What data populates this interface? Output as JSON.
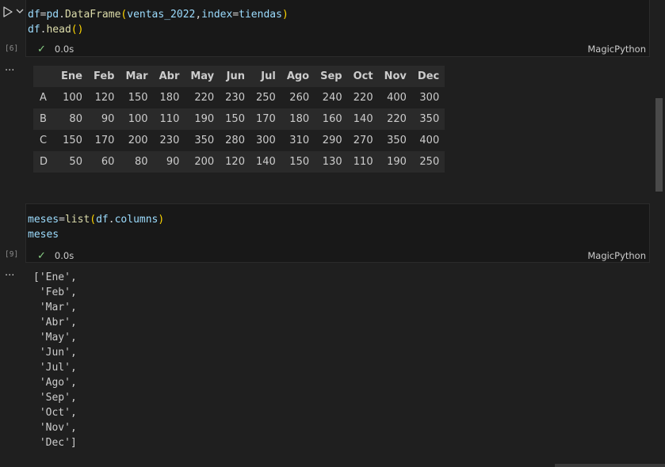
{
  "cells": [
    {
      "exec_count": "[6]",
      "code_lines": [
        [
          [
            "t-var",
            "df"
          ],
          [
            "t-op",
            "="
          ],
          [
            "t-var",
            "pd"
          ],
          [
            "t-op",
            "."
          ],
          [
            "t-fn",
            "DataFrame"
          ],
          [
            "t-paren",
            "("
          ],
          [
            "t-var",
            "ventas_2022"
          ],
          [
            "t-op",
            ","
          ],
          [
            "t-var",
            "index"
          ],
          [
            "t-op",
            "="
          ],
          [
            "t-var",
            "tiendas"
          ],
          [
            "t-paren",
            ")"
          ]
        ],
        [
          [
            "t-var",
            "df"
          ],
          [
            "t-op",
            "."
          ],
          [
            "t-fn",
            "head"
          ],
          [
            "t-paren",
            "()"
          ]
        ]
      ],
      "status_time": "0.0s",
      "kernel": "MagicPython"
    },
    {
      "exec_count": "[9]",
      "code_lines": [
        [
          [
            "t-var",
            "meses"
          ],
          [
            "t-op",
            "="
          ],
          [
            "t-fn",
            "list"
          ],
          [
            "t-paren",
            "("
          ],
          [
            "t-var",
            "df"
          ],
          [
            "t-op",
            "."
          ],
          [
            "t-var",
            "columns"
          ],
          [
            "t-paren",
            ")"
          ]
        ],
        [
          [
            "t-var",
            "meses"
          ]
        ]
      ],
      "status_time": "0.0s",
      "kernel": "MagicPython"
    }
  ],
  "more_label": "···",
  "table": {
    "columns": [
      "Ene",
      "Feb",
      "Mar",
      "Abr",
      "May",
      "Jun",
      "Jul",
      "Ago",
      "Sep",
      "Oct",
      "Nov",
      "Dec"
    ],
    "rows": [
      {
        "index": "A",
        "values": [
          "100",
          "120",
          "150",
          "180",
          "220",
          "230",
          "250",
          "260",
          "240",
          "220",
          "400",
          "300"
        ]
      },
      {
        "index": "B",
        "values": [
          "80",
          "90",
          "100",
          "110",
          "190",
          "150",
          "170",
          "180",
          "160",
          "140",
          "220",
          "350"
        ]
      },
      {
        "index": "C",
        "values": [
          "150",
          "170",
          "200",
          "230",
          "350",
          "280",
          "300",
          "310",
          "290",
          "270",
          "350",
          "400"
        ]
      },
      {
        "index": "D",
        "values": [
          "50",
          "60",
          "80",
          "90",
          "200",
          "120",
          "140",
          "150",
          "130",
          "110",
          "190",
          "250"
        ]
      }
    ]
  },
  "list_output": [
    "['Ene',",
    " 'Feb',",
    " 'Mar',",
    " 'Abr',",
    " 'May',",
    " 'Jun',",
    " 'Jul',",
    " 'Ago',",
    " 'Sep',",
    " 'Oct',",
    " 'Nov',",
    " 'Dec']"
  ]
}
